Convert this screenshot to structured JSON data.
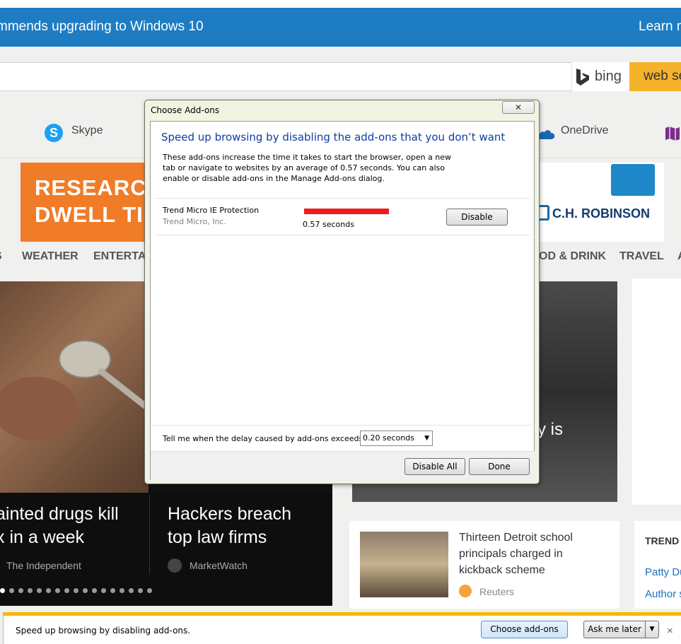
{
  "banner": {
    "message": "mmends upgrading to Windows 10",
    "link": "Learn m"
  },
  "search": {
    "brand": "bing",
    "button": "web se"
  },
  "apps": {
    "skype": "Skype",
    "onedrive": "OneDrive"
  },
  "ads": {
    "left_line1": "RESEARCH:",
    "left_line2": "DWELL TIM",
    "right_logo": "C.H. ROBINSON"
  },
  "nav": [
    "S",
    "WEATHER",
    "ENTERTAI",
    "OD & DRINK",
    "TRAVEL",
    "A"
  ],
  "hero": {
    "left_title_l1": "ainted drugs kill",
    "left_title_l2": "x in a week",
    "left_source": "The Independent",
    "mid_title_l1": "Hackers breach",
    "mid_title_l2": "top law firms",
    "mid_source": "MarketWatch",
    "right_caption": "y is"
  },
  "card": {
    "title": "Thirteen Detroit school principals charged in kickback scheme",
    "source": "Reuters"
  },
  "trending": {
    "heading": "TREND",
    "item1": "Patty Du",
    "item2": "Author s"
  },
  "dialog": {
    "title": "Choose Add-ons",
    "close_glyph": "✕",
    "heading": "Speed up browsing by disabling the add-ons that you don’t want",
    "description": "These add-ons increase the time it takes to start the browser, open a new tab or navigate to websites by an average of 0.57 seconds. You can also enable or disable add-ons in the Manage Add-ons dialog.",
    "addons": [
      {
        "name": "Trend Micro IE Protection",
        "publisher": "Trend Micro, Inc.",
        "load_time": "0.57 seconds",
        "load_fraction": 1.0,
        "bar_color": "#ee1c1c",
        "button": "Disable"
      }
    ],
    "delay_label": "Tell me when the delay caused by add-ons exceeds:",
    "delay_value": "0.20 seconds",
    "disable_all": "Disable All",
    "done": "Done"
  },
  "notification": {
    "text": "Speed up browsing by disabling add-ons.",
    "choose": "Choose add-ons",
    "ask": "Ask me later",
    "close_glyph": "×"
  },
  "colors": {
    "banner": "#1e7cc3",
    "accent_yellow": "#f5b800",
    "dialog_heading": "#0d3ea0"
  }
}
